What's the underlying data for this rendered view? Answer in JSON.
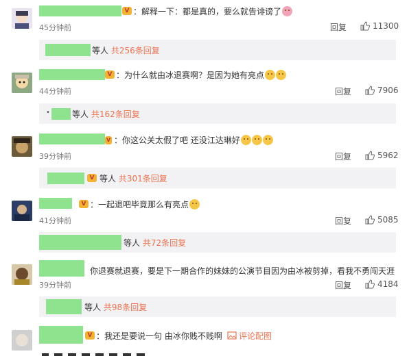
{
  "comments": [
    {
      "text": "：解释一下：都是真的，要么就告诽谤了",
      "time": "45分钟前",
      "reply": "回复",
      "likes": "11300",
      "summary_prefix": "等人",
      "summary_link": "共256条回复"
    },
    {
      "text": "：为什么就由冰退赛啊？是因为她有亮点",
      "time": "44分钟前",
      "reply": "回复",
      "likes": "7906",
      "summary_prefix": "等人",
      "summary_link": "共162条回复"
    },
    {
      "text": "：你这公关太假了吧 还没江达琳好",
      "time": "39分钟前",
      "reply": "回复",
      "likes": "5962",
      "summary_prefix": "等人",
      "summary_link": "共301条回复"
    },
    {
      "text": "：一起退吧毕竟那么有亮点",
      "time": "41分钟前",
      "reply": "回复",
      "likes": "5085",
      "summary_prefix": "等人",
      "summary_link": "共72条回复"
    },
    {
      "text": "你退赛就退赛，要是下一期合作的妹妹的公演节目因为由冰被剪掉，看我不勇闯天涯",
      "time": "39分钟前",
      "reply": "回复",
      "likes": "4184",
      "summary_prefix": "等人",
      "summary_link": "共98条回复"
    },
    {
      "text": "：我还是要说一句 由冰你贱不贱啊",
      "pic_label": "评论配图"
    }
  ]
}
